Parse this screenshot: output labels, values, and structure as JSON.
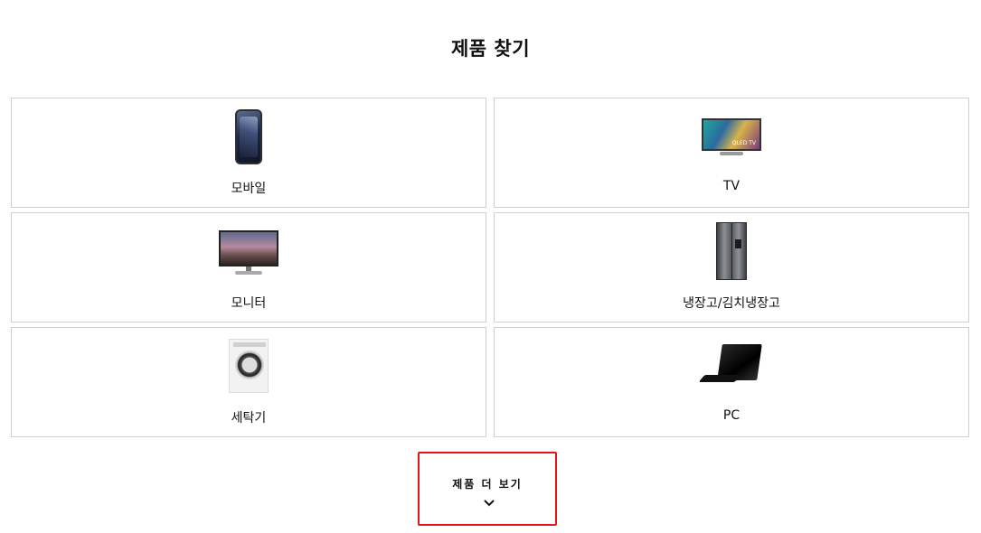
{
  "page": {
    "title": "제품 찾기"
  },
  "products": [
    {
      "label": "모바일",
      "icon": "smartphone-icon"
    },
    {
      "label": "TV",
      "icon": "tv-icon",
      "screen_text": "QLED TV"
    },
    {
      "label": "모니터",
      "icon": "monitor-icon"
    },
    {
      "label": "냉장고/김치냉장고",
      "icon": "refrigerator-icon"
    },
    {
      "label": "세탁기",
      "icon": "washing-machine-icon"
    },
    {
      "label": "PC",
      "icon": "laptop-icon"
    }
  ],
  "more_button": {
    "label": "제품 더 보기",
    "icon": "chevron-down-icon",
    "border_color": "#e0161b"
  }
}
